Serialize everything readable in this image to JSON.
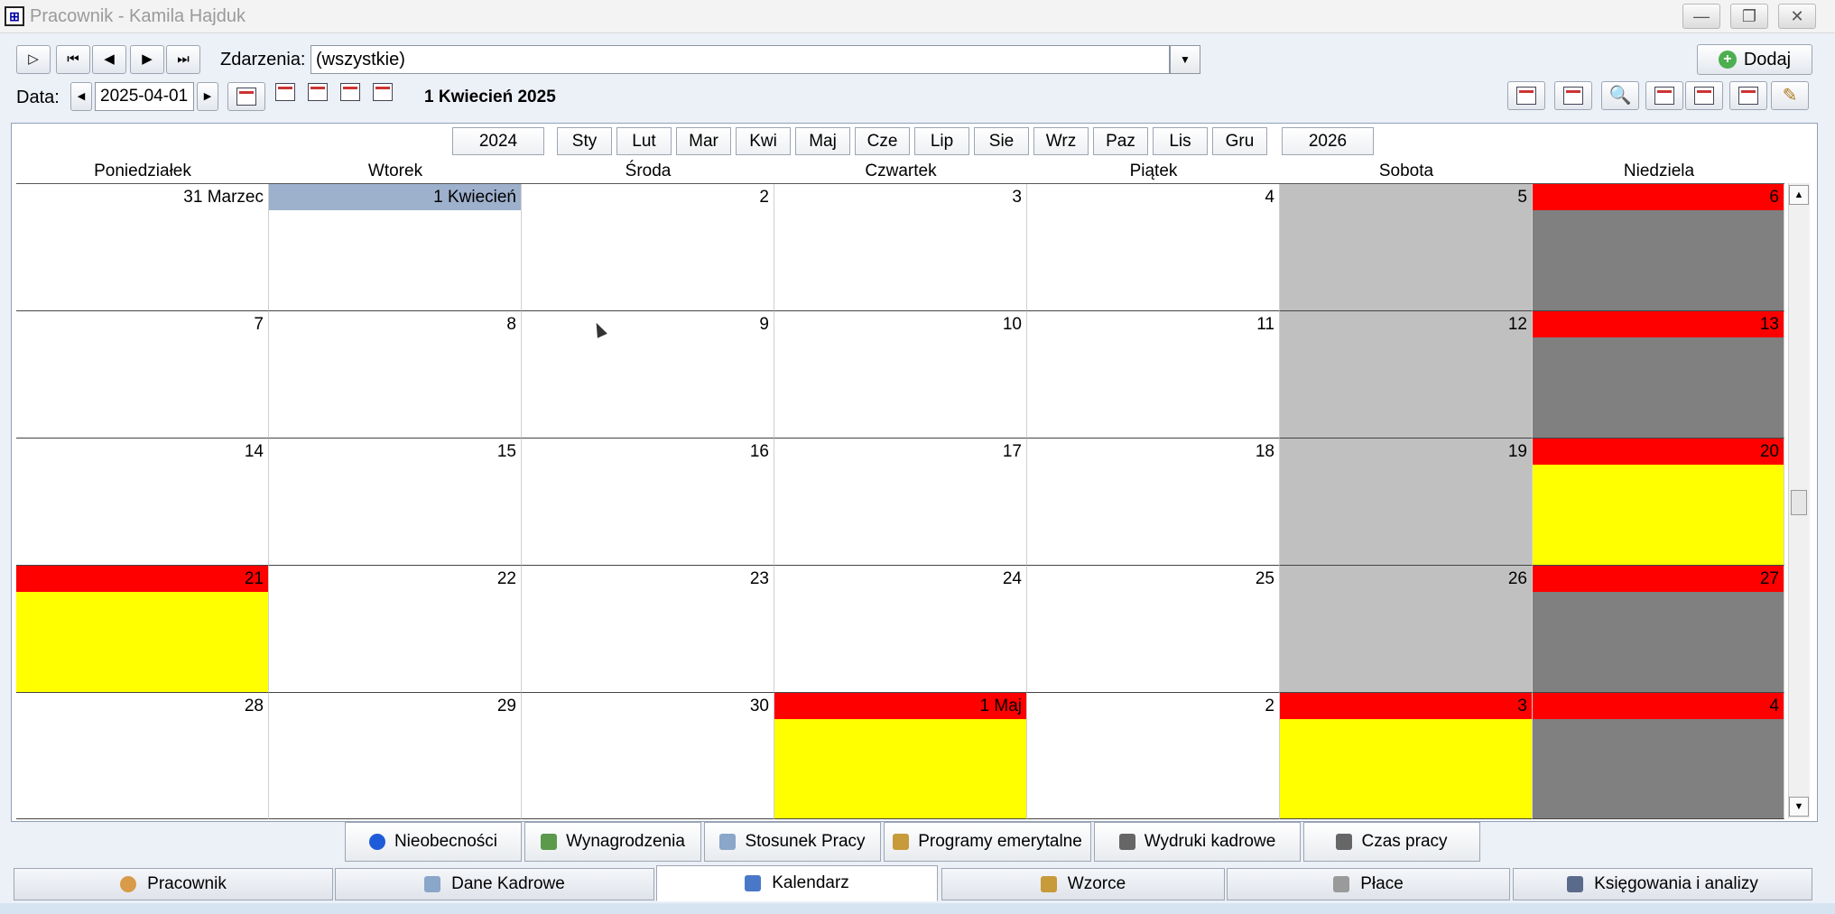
{
  "window": {
    "title": "Pracownik - Kamila Hajduk"
  },
  "toolbar": {
    "zdarzenia_label": "Zdarzenia:",
    "zdarzenia_value": "(wszystkie)",
    "dodaj_label": "Dodaj",
    "data_label": "Data:",
    "date_value": "2025-04-01",
    "date_title": "1 Kwiecień 2025"
  },
  "months": {
    "prev_year": "2024",
    "next_year": "2026",
    "names": [
      "Sty",
      "Lut",
      "Mar",
      "Kwi",
      "Maj",
      "Cze",
      "Lip",
      "Sie",
      "Wrz",
      "Paz",
      "Lis",
      "Gru"
    ]
  },
  "weekdays": [
    "Poniedziałek",
    "Wtorek",
    "Środa",
    "Czwartek",
    "Piątek",
    "Sobota",
    "Niedziela"
  ],
  "weeks": [
    [
      {
        "label": "31 Marzec"
      },
      {
        "label": "1 Kwiecień",
        "today": true
      },
      {
        "label": "2"
      },
      {
        "label": "3"
      },
      {
        "label": "4"
      },
      {
        "label": "5",
        "kind": "sat"
      },
      {
        "label": "6",
        "kind": "sun",
        "redhd": true
      }
    ],
    [
      {
        "label": "7"
      },
      {
        "label": "8"
      },
      {
        "label": "9"
      },
      {
        "label": "10"
      },
      {
        "label": "11"
      },
      {
        "label": "12",
        "kind": "sat"
      },
      {
        "label": "13",
        "kind": "sun",
        "redhd": true
      }
    ],
    [
      {
        "label": "14"
      },
      {
        "label": "15"
      },
      {
        "label": "16"
      },
      {
        "label": "17"
      },
      {
        "label": "18"
      },
      {
        "label": "19",
        "kind": "sat"
      },
      {
        "label": "20",
        "kind": "hol",
        "redhd": true
      }
    ],
    [
      {
        "label": "21",
        "kind": "hol",
        "redhd": true
      },
      {
        "label": "22"
      },
      {
        "label": "23"
      },
      {
        "label": "24"
      },
      {
        "label": "25"
      },
      {
        "label": "26",
        "kind": "sat"
      },
      {
        "label": "27",
        "kind": "sun",
        "redhd": true
      }
    ],
    [
      {
        "label": "28"
      },
      {
        "label": "29"
      },
      {
        "label": "30"
      },
      {
        "label": "1 Maj",
        "kind": "hol",
        "redhd": true
      },
      {
        "label": "2"
      },
      {
        "label": "3",
        "kind": "hol",
        "redhd": true
      },
      {
        "label": "4",
        "kind": "sun",
        "redhd": true
      }
    ]
  ],
  "subtabs": [
    "Nieobecności",
    "Wynagrodzenia",
    "Stosunek Pracy",
    "Programy emerytalne",
    "Wydruki kadrowe",
    "Czas pracy"
  ],
  "maintabs": [
    "Pracownik",
    "Dane Kadrowe",
    "Kalendarz",
    "Wzorce",
    "Płace",
    "Księgowania i analizy"
  ],
  "active_maintab": "Kalendarz",
  "colors": {
    "holiday_header": "#ff0000",
    "holiday_fill": "#ffff00",
    "saturday": "#c0c0c0",
    "sunday": "#808080",
    "today_header": "#9db0cc"
  }
}
